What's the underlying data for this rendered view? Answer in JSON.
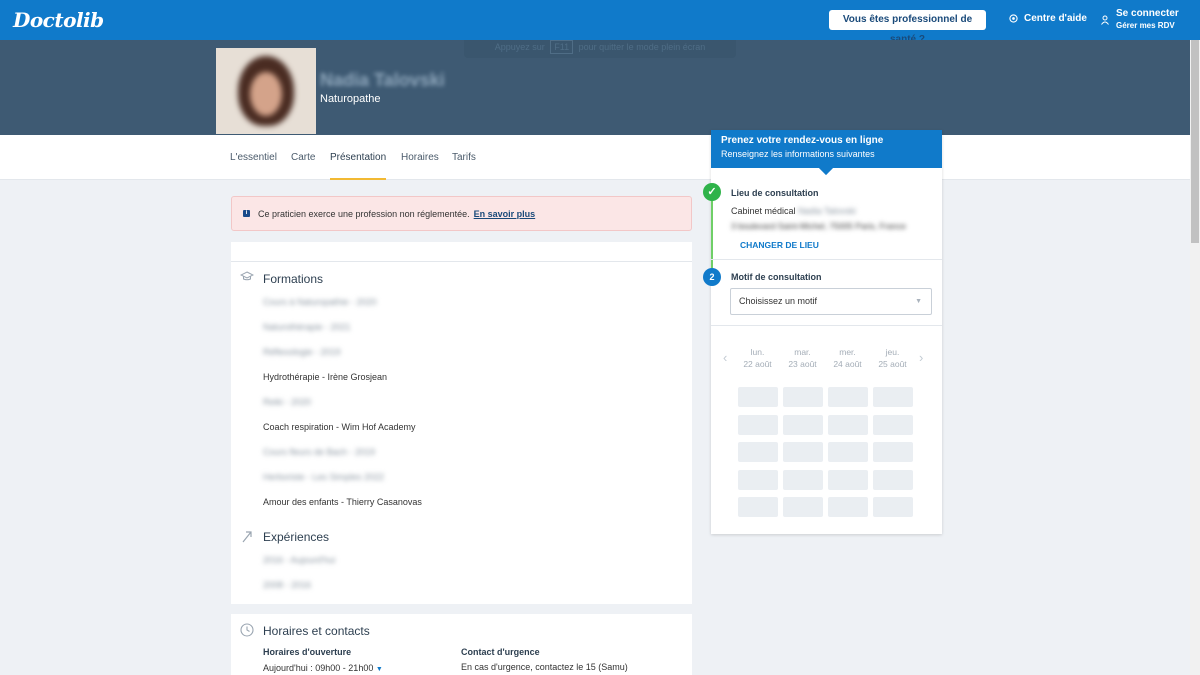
{
  "header": {
    "logo": "Doctolib",
    "pro_button": "Vous êtes professionnel de santé ?",
    "help": "Centre d'aide",
    "login_title": "Se connecter",
    "login_sub": "Gérer mes RDV"
  },
  "fullscreen_hint": {
    "before": "Appuyez sur",
    "key": "F11",
    "after": "pour quitter le mode plein écran"
  },
  "profile": {
    "name": "Nadia Talovski",
    "specialty": "Naturopathe"
  },
  "tabs": [
    {
      "label": "L'essentiel",
      "active": false
    },
    {
      "label": "Carte",
      "active": false
    },
    {
      "label": "Présentation",
      "active": true
    },
    {
      "label": "Horaires",
      "active": false
    },
    {
      "label": "Tarifs",
      "active": false
    }
  ],
  "alert": {
    "text": "Ce praticien exerce une profession non réglementée.",
    "link": "En savoir plus"
  },
  "formations": {
    "title": "Formations",
    "items": [
      "Cours à Naturopathie - 2020",
      "Naturothérapie - 2021",
      "Réflexologie - 2019",
      "Hydrothérapie - Irène Grosjean",
      "Reiki - 2020",
      "Coach respiration - Wim Hof Academy",
      "Cours fleurs de Bach - 2019",
      "Herboriste - Les Simples 2022",
      "Amour des enfants - Thierry Casanovas"
    ]
  },
  "experiences": {
    "title": "Expériences",
    "items": [
      "2016 - Aujourd'hui",
      "2008 - 2016"
    ]
  },
  "contacts": {
    "title": "Horaires et contacts",
    "hours_label": "Horaires d'ouverture",
    "hours_today": "Aujourd'hui :",
    "hours_value": "09h00 - 21h00",
    "urgency_label": "Contact d'urgence",
    "urgency_text": "En cas d'urgence, contactez le 15 (Samu)"
  },
  "booking": {
    "title": "Prenez votre rendez-vous en ligne",
    "subtitle": "Renseignez les informations suivantes",
    "step1_label": "Lieu de consultation",
    "step1_value": "Cabinet médical",
    "step1_value_blurred": "Nadia Talovski",
    "step1_address": "3 boulevard Saint-Michel, 75005 Paris, France",
    "change_lieu": "CHANGER DE LIEU",
    "step2_number": "2",
    "step2_label": "Motif de consultation",
    "select_placeholder": "Choisissez un motif",
    "days": [
      {
        "day": "lun.",
        "date": "22 août"
      },
      {
        "day": "mar.",
        "date": "23 août"
      },
      {
        "day": "mer.",
        "date": "24 août"
      },
      {
        "day": "jeu.",
        "date": "25 août"
      }
    ]
  },
  "colors": {
    "brand": "#107ACA",
    "header_band": "#3e5a73",
    "success": "#2fb34a",
    "tab_active_underline": "#f2b933"
  }
}
